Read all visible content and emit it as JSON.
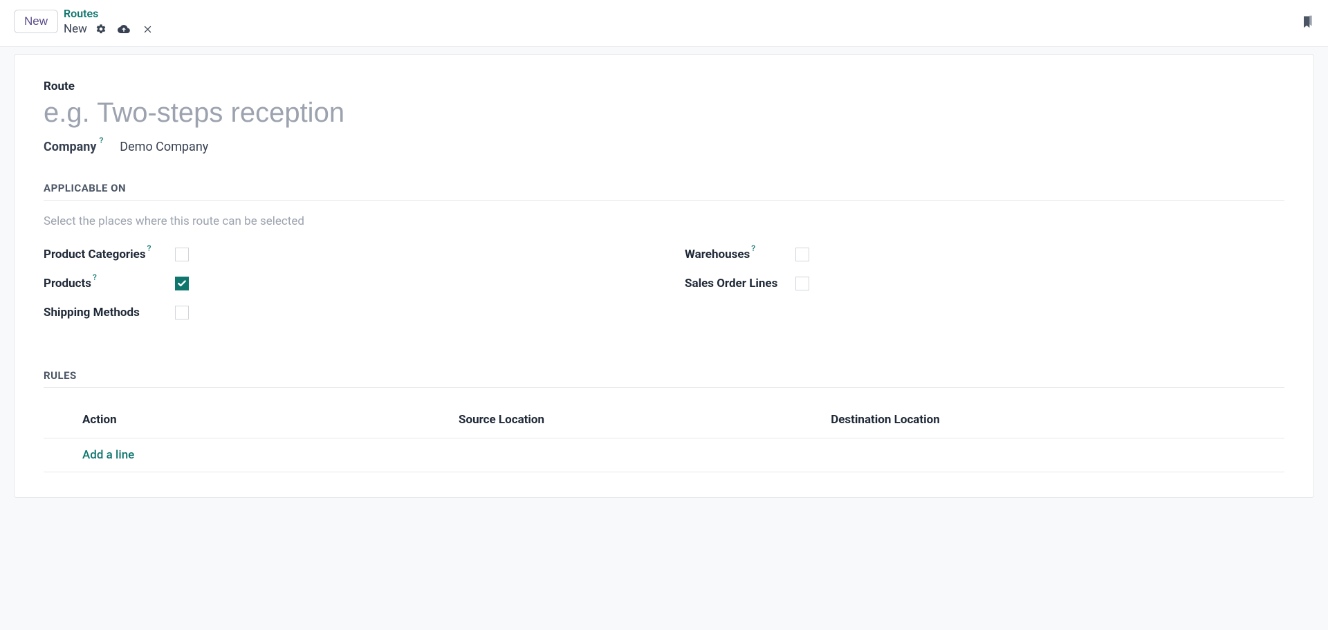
{
  "header": {
    "new_button": "New",
    "breadcrumb_root": "Routes",
    "breadcrumb_current": "New"
  },
  "form": {
    "route_label": "Route",
    "route_placeholder": "e.g. Two-steps reception",
    "company_label": "Company",
    "company_value": "Demo Company"
  },
  "applicable": {
    "section_title": "APPLICABLE ON",
    "hint": "Select the places where this route can be selected",
    "product_categories_label": "Product Categories",
    "product_categories_checked": false,
    "products_label": "Products",
    "products_checked": true,
    "shipping_methods_label": "Shipping Methods",
    "shipping_methods_checked": false,
    "warehouses_label": "Warehouses",
    "warehouses_checked": false,
    "sales_order_lines_label": "Sales Order Lines",
    "sales_order_lines_checked": false
  },
  "rules": {
    "section_title": "RULES",
    "columns": {
      "action": "Action",
      "source": "Source Location",
      "destination": "Destination Location"
    },
    "add_line": "Add a line",
    "rows": []
  },
  "help_marker": "?"
}
